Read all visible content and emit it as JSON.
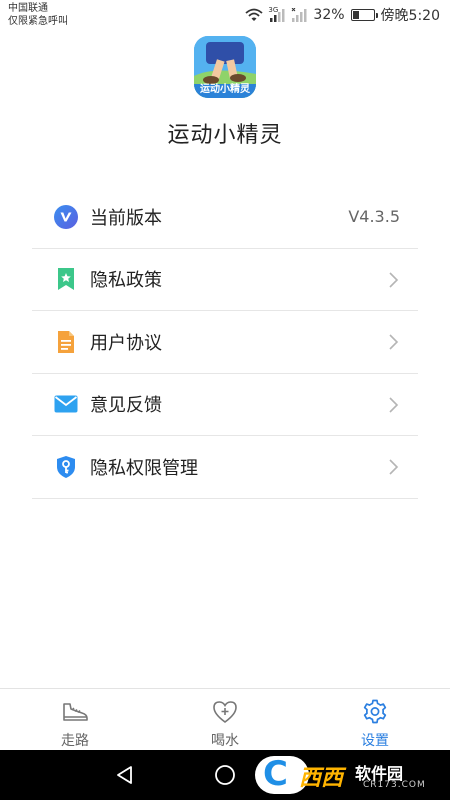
{
  "status_bar": {
    "carrier_line1": "中国联通",
    "carrier_line2": "仅限紧急呼叫",
    "battery_percent": "32%",
    "time": "傍晚5:20",
    "network_badge": "3G",
    "battery_level": 0.32
  },
  "app": {
    "logo_text": "运动小精灵",
    "title": "运动小精灵"
  },
  "menu": {
    "items": [
      {
        "label": "当前版本",
        "value": "V4.3.5",
        "icon": "version-v-icon",
        "has_chevron": false
      },
      {
        "label": "隐私政策",
        "icon": "bookmark-star-icon",
        "has_chevron": true
      },
      {
        "label": "用户协议",
        "icon": "document-icon",
        "has_chevron": true
      },
      {
        "label": "意见反馈",
        "icon": "mail-icon",
        "has_chevron": true
      },
      {
        "label": "隐私权限管理",
        "icon": "shield-key-icon",
        "has_chevron": true
      }
    ]
  },
  "tabbar": {
    "tabs": [
      {
        "label": "走路",
        "icon": "shoe-icon",
        "active": false
      },
      {
        "label": "喝水",
        "icon": "heart-plus-icon",
        "active": false
      },
      {
        "label": "设置",
        "icon": "gear-icon",
        "active": true
      }
    ]
  },
  "watermark": {
    "brand": "西西",
    "name": "软件园",
    "domain": "CR173.COM",
    "letter": "C"
  },
  "colors": {
    "accent": "#2b7fe0",
    "privacy_icon": "#3cc78a",
    "doc_icon": "#f5a23c",
    "mail_icon": "#2ea2f0",
    "shield_icon": "#2d8cf0"
  }
}
